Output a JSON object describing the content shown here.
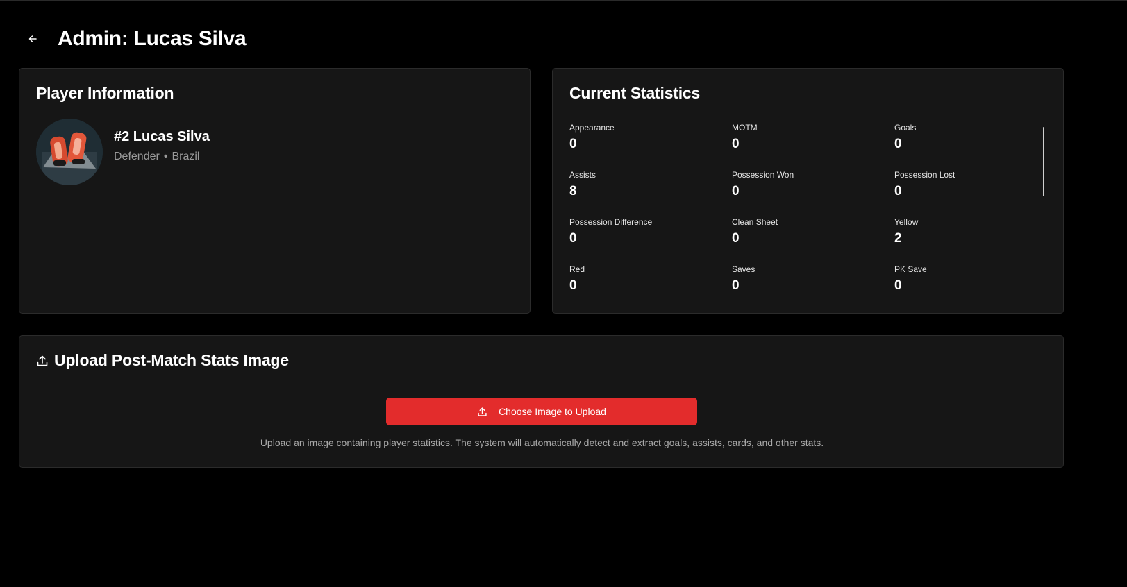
{
  "header": {
    "title": "Admin: Lucas Silva",
    "back_icon": "arrow-left-icon"
  },
  "player_info": {
    "title": "Player Information",
    "name": "#2 Lucas Silva",
    "position": "Defender",
    "separator": "•",
    "country": "Brazil"
  },
  "stats": {
    "title": "Current Statistics",
    "items": [
      {
        "label": "Appearance",
        "value": "0"
      },
      {
        "label": "MOTM",
        "value": "0"
      },
      {
        "label": "Goals",
        "value": "0"
      },
      {
        "label": "Assists",
        "value": "8"
      },
      {
        "label": "Possession Won",
        "value": "0"
      },
      {
        "label": "Possession Lost",
        "value": "0"
      },
      {
        "label": "Possession Difference",
        "value": "0"
      },
      {
        "label": "Clean Sheet",
        "value": "0"
      },
      {
        "label": "Yellow",
        "value": "2"
      },
      {
        "label": "Red",
        "value": "0"
      },
      {
        "label": "Saves",
        "value": "0"
      },
      {
        "label": "PK Save",
        "value": "0"
      }
    ]
  },
  "upload": {
    "title": "Upload Post-Match Stats Image",
    "icon": "upload-icon",
    "button_label": "Choose Image to Upload",
    "help_text": "Upload an image containing player statistics. The system will automatically detect and extract goals, assists, cards, and other stats."
  },
  "colors": {
    "background": "#000000",
    "card": "#161616",
    "accent": "#e32c2c",
    "muted_text": "#9a9a9a"
  }
}
